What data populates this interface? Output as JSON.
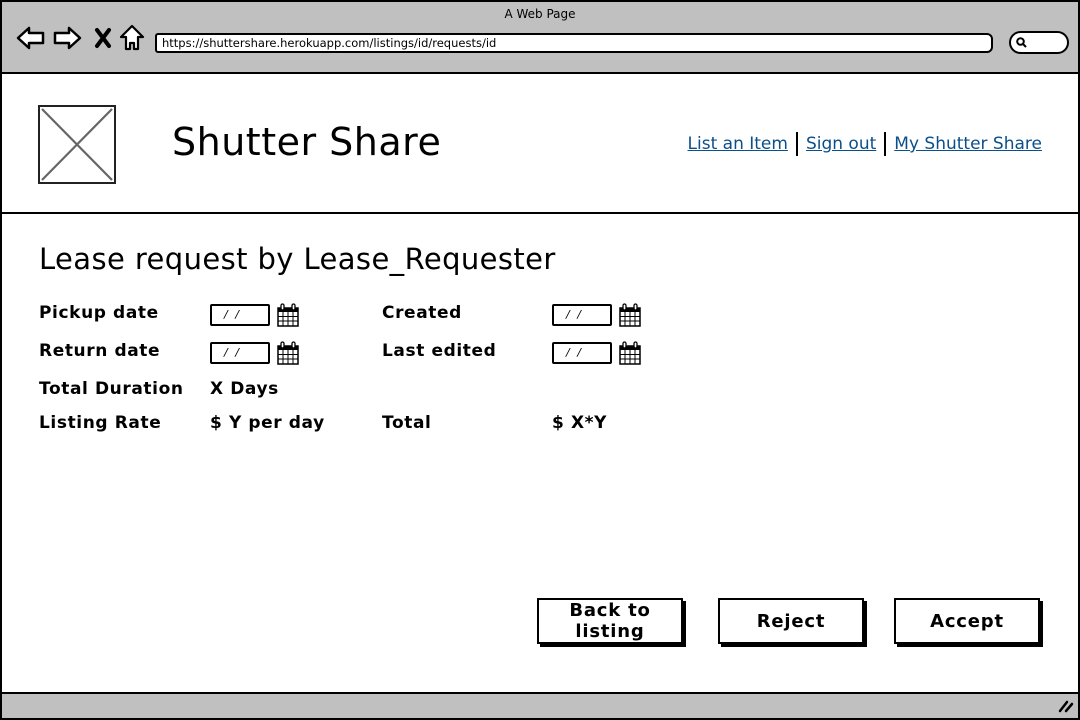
{
  "browser": {
    "window_title": "A Web Page",
    "url": "https://shuttershare.herokuapp.com/listings/id/requests/id",
    "nav_icons": [
      "back-arrow-icon",
      "forward-arrow-icon",
      "stop-x-icon",
      "home-icon"
    ],
    "search_icon": "search-icon"
  },
  "header": {
    "site_title": "Shutter Share",
    "logo": "image-placeholder",
    "links": [
      {
        "label": "List an Item"
      },
      {
        "label": "Sign out"
      },
      {
        "label": "My Shutter Share"
      }
    ],
    "link_color": "#0b4f8a"
  },
  "content": {
    "title": "Lease request by Lease_Requester",
    "fields": {
      "pickup_date": {
        "label": "Pickup date",
        "value": "/ /"
      },
      "return_date": {
        "label": "Return date",
        "value": "/ /"
      },
      "created": {
        "label": "Created",
        "value": "/ /"
      },
      "last_edited": {
        "label": "Last edited",
        "value": "/ /"
      },
      "total_duration": {
        "label": "Total Duration",
        "value": "X Days"
      },
      "listing_rate": {
        "label": "Listing Rate",
        "value": "$ Y per day"
      },
      "total": {
        "label": "Total",
        "value": "$ X*Y"
      }
    }
  },
  "actions": {
    "back_label": "Back to listing",
    "reject_label": "Reject",
    "accept_label": "Accept"
  }
}
